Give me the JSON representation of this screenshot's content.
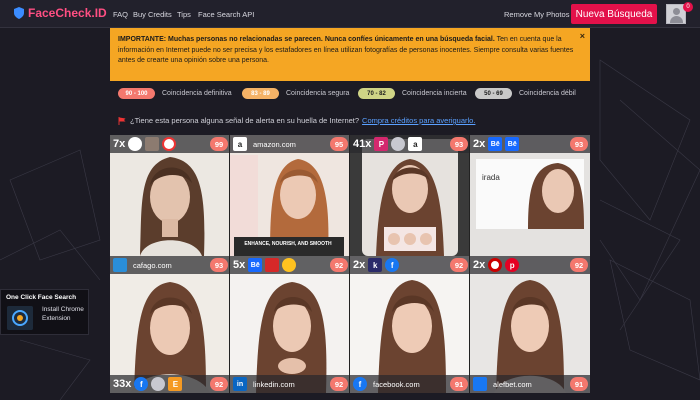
{
  "nav": {
    "brand": "FaceCheck.ID",
    "links": [
      "FAQ",
      "Buy Credits",
      "Tips",
      "Face Search API"
    ],
    "remove": "Remove My Photos",
    "new_search": "Nueva Búsqueda",
    "notification_count": "0"
  },
  "warning": {
    "bold": "IMPORTANTE: Muchas personas no relacionadas se parecen. Nunca confíes únicamente en una búsqueda facial.",
    "rest": " Ten en cuenta que la información en Internet puede no ser precisa y los estafadores en línea utilizan fotografías de personas inocentes. Siempre consulta varias fuentes antes de crearte una opinión sobre una persona.",
    "close": "×"
  },
  "legend": [
    {
      "range": "90 - 100",
      "label": "Coincidencia definitiva",
      "color": "#f4786e"
    },
    {
      "range": "83 - 89",
      "label": "Coincidencia segura",
      "color": "#f5b266"
    },
    {
      "range": "70 - 82",
      "label": "Coincidencia incierta",
      "color": "#cfd486"
    },
    {
      "range": "50 - 69",
      "label": "Coincidencia débil",
      "color": "#c9c9c9"
    }
  ],
  "alert": {
    "text": "¿Tiene esta persona alguna señal de alerta en su huella de Internet?",
    "link": "Compra créditos para averiguarlo."
  },
  "results": [
    {
      "count": "7x",
      "domain": "",
      "icons": [
        "white-circle-icon",
        "photo-thumb-icon",
        "red-circle-icon"
      ],
      "score": "99",
      "bar": "top"
    },
    {
      "count": "",
      "domain": "amazon.com",
      "icons": [
        "amazon-icon"
      ],
      "score": "95",
      "bar": "top"
    },
    {
      "count": "41x",
      "domain": "",
      "icons": [
        "pink-p-icon",
        "globe-icon",
        "amazon-icon"
      ],
      "score": "93",
      "bar": "top"
    },
    {
      "count": "2x",
      "domain": "",
      "icons": [
        "behance-icon",
        "behance-icon"
      ],
      "score": "93",
      "bar": "top"
    },
    {
      "count": "",
      "domain": "cafago.com",
      "icons": [
        "cafago-icon"
      ],
      "score": "93",
      "bar": "top"
    },
    {
      "count": "5x",
      "domain": "",
      "icons": [
        "behance-icon",
        "red-logo-icon",
        "walmart-icon"
      ],
      "score": "92",
      "bar": "top"
    },
    {
      "count": "2x",
      "domain": "",
      "icons": [
        "k-icon",
        "facebook-icon"
      ],
      "score": "92",
      "bar": "top"
    },
    {
      "count": "2x",
      "domain": "",
      "icons": [
        "target-icon",
        "pinterest-icon"
      ],
      "score": "92",
      "bar": "top"
    },
    {
      "count": "33x",
      "domain": "",
      "icons": [
        "facebook-icon",
        "globe-icon",
        "e-icon"
      ],
      "score": "92",
      "bar": "bottom"
    },
    {
      "count": "",
      "domain": "linkedin.com",
      "icons": [
        "linkedin-icon"
      ],
      "score": "92",
      "bar": "bottom"
    },
    {
      "count": "",
      "domain": "facebook.com",
      "icons": [
        "facebook-icon"
      ],
      "score": "91",
      "bar": "bottom"
    },
    {
      "count": "",
      "domain": "alefbet.com",
      "icons": [
        "alefbet-icon"
      ],
      "score": "91",
      "bar": "bottom"
    }
  ],
  "ad_texts": {
    "enhance": "ENHANCE, NOURISH, AND SMOOTH",
    "irada": "irada"
  },
  "extension": {
    "title": "One Click Face Search",
    "text": "Install Chrome Extension"
  }
}
